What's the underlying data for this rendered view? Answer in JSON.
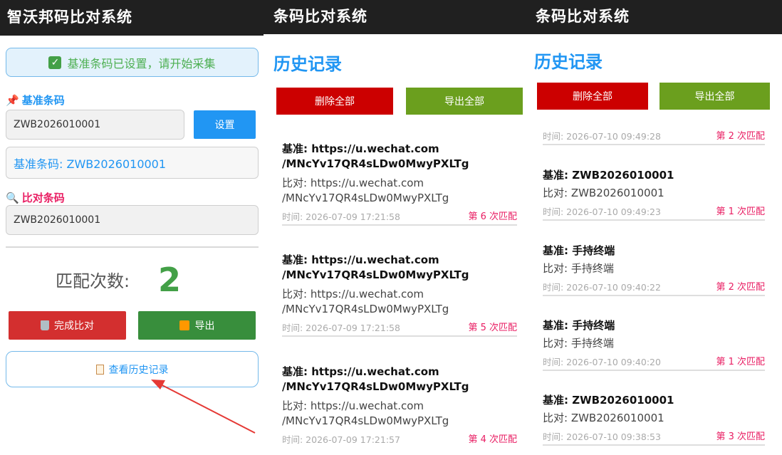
{
  "panel1": {
    "title": "智沃邦码比对系统",
    "status_icon": "check-icon",
    "status": "基准条码已设置，请开始采集",
    "base_label": "基准条码",
    "base_input_value": "ZWB2026010001",
    "set_button": "设置",
    "base_display": "基准条码: ZWB2026010001",
    "compare_label": "比对条码",
    "compare_input_value": "ZWB2026010001",
    "match_label": "匹配次数:",
    "match_count": "2",
    "finish_button": "完成比对",
    "export_button": "导出",
    "history_button": "查看历史记录"
  },
  "panel2": {
    "title": "条码比对系统",
    "heading": "历史记录",
    "delete_all": "删除全部",
    "export_all": "导出全部",
    "records": [
      {
        "base1": "基准: https://u.wechat.com",
        "base2": "/MNcYv17QR4sLDw0MwyPXLTg",
        "cmp1": "比对: https://u.wechat.com",
        "cmp2": "/MNcYv17QR4sLDw0MwyPXLTg",
        "time": "时间: 2026-07-09 17:21:58",
        "nth": "第 6 次匹配"
      },
      {
        "base1": "基准: https://u.wechat.com",
        "base2": "/MNcYv17QR4sLDw0MwyPXLTg",
        "cmp1": "比对: https://u.wechat.com",
        "cmp2": "/MNcYv17QR4sLDw0MwyPXLTg",
        "time": "时间: 2026-07-09 17:21:58",
        "nth": "第 5 次匹配"
      },
      {
        "base1": "基准: https://u.wechat.com",
        "base2": "/MNcYv17QR4sLDw0MwyPXLTg",
        "cmp1": "比对: https://u.wechat.com",
        "cmp2": "/MNcYv17QR4sLDw0MwyPXLTg",
        "time": "时间: 2026-07-09 17:21:57",
        "nth": "第 4 次匹配"
      }
    ]
  },
  "panel3": {
    "title": "条码比对系统",
    "heading": "历史记录",
    "delete_all": "删除全部",
    "export_all": "导出全部",
    "first_meta": {
      "time": "时间: 2026-07-10 09:49:28",
      "nth": "第 2 次匹配"
    },
    "records": [
      {
        "base": "基准: ZWB2026010001",
        "cmp": "比对: ZWB2026010001",
        "time": "时间: 2026-07-10 09:49:23",
        "nth": "第 1 次匹配"
      },
      {
        "base": "基准: 手持终端",
        "cmp": "比对: 手持终端",
        "time": "时间: 2026-07-10 09:40:22",
        "nth": "第 2 次匹配"
      },
      {
        "base": "基准: 手持终端",
        "cmp": "比对: 手持终端",
        "time": "时间: 2026-07-10 09:40:20",
        "nth": "第 1 次匹配"
      },
      {
        "base": "基准: ZWB2026010001",
        "cmp": "比对: ZWB2026010001",
        "time": "时间: 2026-07-10 09:38:53",
        "nth": "第 3 次匹配"
      }
    ]
  },
  "colors": {
    "accent_blue": "#2196f3",
    "match_green": "#43a047",
    "pink": "#e91e63",
    "danger_red": "#d32f2f",
    "export_green": "#388e3c",
    "appbar": "#202020"
  }
}
